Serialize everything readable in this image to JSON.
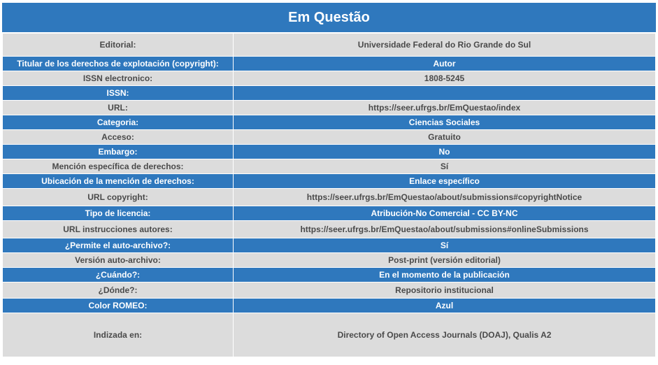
{
  "title": "Em Questão",
  "rows": [
    {
      "label": "Editorial:",
      "value": "Universidade Federal do Rio Grande do Sul"
    },
    {
      "label": "Titular de los derechos de explotación (copyright):",
      "value": "Autor"
    },
    {
      "label": "ISSN electronico:",
      "value": "1808-5245"
    },
    {
      "label": "ISSN:",
      "value": ""
    },
    {
      "label": "URL:",
      "value": "https://seer.ufrgs.br/EmQuestao/index"
    },
    {
      "label": "Categoria:",
      "value": "Ciencias Sociales"
    },
    {
      "label": "Acceso:",
      "value": "Gratuito"
    },
    {
      "label": "Embargo:",
      "value": "No"
    },
    {
      "label": "Mención específica de derechos:",
      "value": "Sí"
    },
    {
      "label": "Ubicación de la mención de derechos:",
      "value": "Enlace específico"
    },
    {
      "label": "URL copyright:",
      "value": "https://seer.ufrgs.br/EmQuestao/about/submissions#copyrightNotice"
    },
    {
      "label": "Tipo de licencia:",
      "value": "Atribución-No Comercial - CC BY-NC"
    },
    {
      "label": "URL instrucciones autores:",
      "value": "https://seer.ufrgs.br/EmQuestao/about/submissions#onlineSubmissions"
    },
    {
      "label": "¿Permite el auto-archivo?:",
      "value": "Sí"
    },
    {
      "label": "Versión auto-archivo:",
      "value": "Post-print (versión editorial)"
    },
    {
      "label": "¿Cuándo?:",
      "value": "En el momento de la publicación"
    },
    {
      "label": "¿Dónde?:",
      "value": "Repositorio institucional"
    },
    {
      "label": "Color ROMEO:",
      "value": "Azul"
    },
    {
      "label": "Indizada en:",
      "value": "Directory of Open Access Journals (DOAJ), Qualis A2"
    }
  ]
}
